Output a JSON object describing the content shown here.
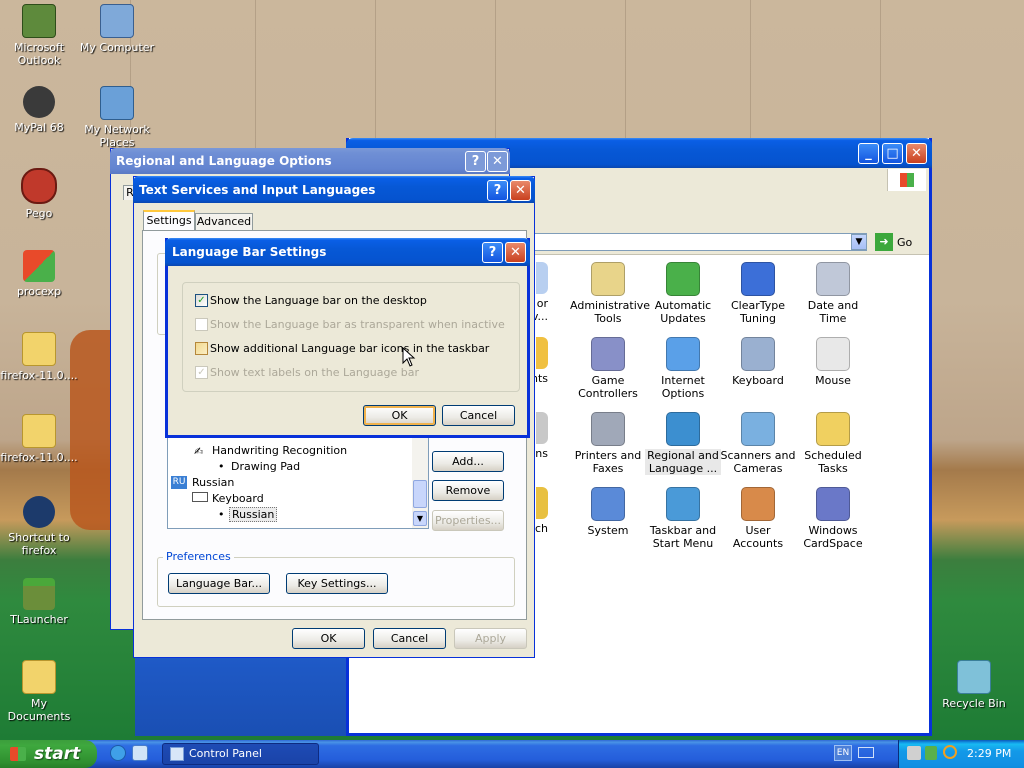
{
  "desktop_icons": [
    {
      "label": "Microsoft Outlook",
      "icon": "outlook-icon",
      "color": "#5e8a3c"
    },
    {
      "label": "My Computer",
      "icon": "computer-icon",
      "color": "#7fa9d9"
    },
    {
      "label": "MyPal 68",
      "icon": "raccoon-icon",
      "color": "#3a3a3a"
    },
    {
      "label": "My Network Places",
      "icon": "network-icon",
      "color": "#6aa0d8"
    },
    {
      "label": "Pego",
      "icon": "pego-icon",
      "color": "#c0392b"
    },
    {
      "label": "procexp",
      "icon": "windows-icon",
      "color": "#e8a23a"
    },
    {
      "label": "firefox-11.0....",
      "icon": "zip-folder-icon",
      "color": "#f2d36b"
    },
    {
      "label": "firefox-11.0....",
      "icon": "folder-icon",
      "color": "#f2d36b"
    },
    {
      "label": "Shortcut to firefox",
      "icon": "firefox-icon",
      "color": "#1c3a6b"
    },
    {
      "label": "TLauncher",
      "icon": "minecraft-icon",
      "color": "#6b8e3a"
    },
    {
      "label": "My Documents",
      "icon": "documents-icon",
      "color": "#f2d36b"
    },
    {
      "label": "Recycle Bin",
      "icon": "recycle-bin-icon",
      "color": "#7fc1d9"
    }
  ],
  "control_panel": {
    "go_label": "Go",
    "items": [
      {
        "label": "or\nov...",
        "icon": "accessibility-icon"
      },
      {
        "label": "Administrative\nTools",
        "icon": "admin-tools-icon"
      },
      {
        "label": "Automatic\nUpdates",
        "icon": "windows-update-icon"
      },
      {
        "label": "ClearType\nTuning",
        "icon": "cleartype-icon"
      },
      {
        "label": "Date and Time",
        "icon": "clock-icon"
      },
      {
        "label": "nts",
        "icon": "fonts-icon"
      },
      {
        "label": "Game\nControllers",
        "icon": "gamepad-icon"
      },
      {
        "label": "Internet\nOptions",
        "icon": "internet-options-icon"
      },
      {
        "label": "Keyboard",
        "icon": "keyboard-icon"
      },
      {
        "label": "Mouse",
        "icon": "mouse-icon"
      },
      {
        "label": "Options",
        "icon": "phone-icon"
      },
      {
        "label": "Printers and\nFaxes",
        "icon": "printer-icon"
      },
      {
        "label": "Regional and\nLanguage ...",
        "icon": "globe-icon"
      },
      {
        "label": "Scanners and\nCameras",
        "icon": "scanner-icon"
      },
      {
        "label": "Scheduled\nTasks",
        "icon": "scheduled-tasks-icon"
      },
      {
        "label": "ech",
        "icon": "speech-icon"
      },
      {
        "label": "System",
        "icon": "system-icon"
      },
      {
        "label": "Taskbar and\nStart Menu",
        "icon": "taskbar-icon"
      },
      {
        "label": "User Accounts",
        "icon": "users-icon"
      },
      {
        "label": "Windows\nCardSpace",
        "icon": "cardspace-icon"
      }
    ]
  },
  "regional_dialog": {
    "title": "Regional and Language Options",
    "tab_first_letter": "R"
  },
  "text_services": {
    "title": "Text Services and Input Languages",
    "tabs": [
      "Settings",
      "Advanced"
    ],
    "tree": [
      {
        "text": "Handwriting Recognition",
        "level": 1,
        "icon": "pen-icon"
      },
      {
        "text": "Drawing Pad",
        "level": 2
      },
      {
        "text": "Russian",
        "level": 0,
        "icon": "ru-icon",
        "badge": "RU"
      },
      {
        "text": "Keyboard",
        "level": 1,
        "icon": "keyboard-small-icon"
      },
      {
        "text": "Russian",
        "level": 2
      }
    ],
    "buttons": {
      "add": "Add...",
      "remove": "Remove",
      "properties": "Properties..."
    },
    "preferences_label": "Preferences",
    "language_bar": "Language Bar...",
    "key_settings": "Key Settings...",
    "ok": "OK",
    "cancel": "Cancel",
    "apply": "Apply"
  },
  "language_bar_settings": {
    "title": "Language Bar Settings",
    "options": [
      {
        "label": "Show the Language bar on the desktop",
        "checked": true,
        "enabled": true
      },
      {
        "label": "Show the Language bar as transparent when inactive",
        "checked": false,
        "enabled": false
      },
      {
        "label": "Show additional Language bar icons in the taskbar",
        "checked": false,
        "enabled": true
      },
      {
        "label": "Show text labels on the Language bar",
        "checked": true,
        "enabled": false
      }
    ],
    "ok": "OK",
    "cancel": "Cancel"
  },
  "taskbar": {
    "start_label": "start",
    "task_label": "Control Panel",
    "lang_indicator": "EN",
    "clock": "2:29 PM"
  }
}
